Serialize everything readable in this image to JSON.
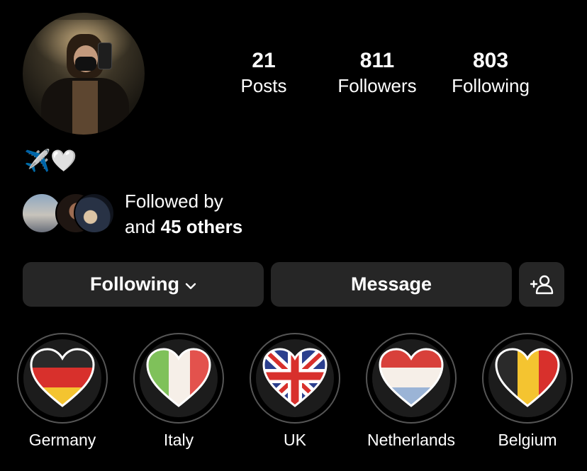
{
  "profile": {
    "stats": [
      {
        "value": "21",
        "label": "Posts"
      },
      {
        "value": "811",
        "label": "Followers"
      },
      {
        "value": "803",
        "label": "Following"
      }
    ],
    "bio": "✈️🤍"
  },
  "followed_by": {
    "line1": "Followed by",
    "line2_prefix": "and ",
    "line2_bold": "45 others"
  },
  "actions": {
    "following_label": "Following",
    "message_label": "Message",
    "add_person_icon": "person-add-icon"
  },
  "highlights": [
    {
      "label": "Germany",
      "icon": "heart-flag-germany-icon"
    },
    {
      "label": "Italy",
      "icon": "heart-flag-italy-icon"
    },
    {
      "label": "UK",
      "icon": "heart-flag-uk-icon"
    },
    {
      "label": "Netherlands",
      "icon": "heart-flag-netherlands-icon"
    },
    {
      "label": "Belgium",
      "icon": "heart-flag-belgium-icon"
    }
  ],
  "colors": {
    "background": "#000000",
    "button": "#262626",
    "text": "#ffffff"
  }
}
